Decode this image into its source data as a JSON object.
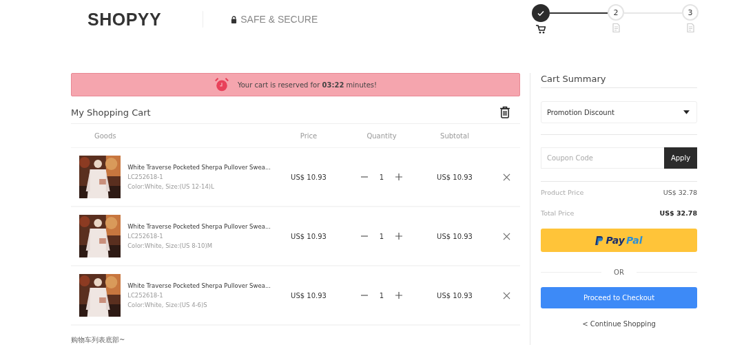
{
  "header": {
    "logo": "SHOPYY",
    "secure_label": "SAFE & SECURE"
  },
  "steps": [
    {
      "kind": "cart",
      "done": true
    },
    {
      "kind": "document",
      "number": "2",
      "done": false
    },
    {
      "kind": "document",
      "number": "3",
      "done": false
    }
  ],
  "reservation_banner": {
    "text": "Your cart is reserved for **03:22** minutes!"
  },
  "cart": {
    "title": "My Shopping Cart",
    "columns": [
      "Goods",
      "Price",
      "Quantity",
      "Subtotal"
    ],
    "rows": [
      {
        "name": "White Traverse Pocketed Sherpa Pullover Swea...",
        "sku": "LC252618-1",
        "variant": "Color:White, Size:(US 12-14)L",
        "price": "US$ 10.93",
        "quantity": "1",
        "subtotal": "US$ 10.93"
      },
      {
        "name": "White Traverse Pocketed Sherpa Pullover Swea...",
        "sku": "LC252618-1",
        "variant": "Color:White, Size:(US 8-10)M",
        "price": "US$ 10.93",
        "quantity": "1",
        "subtotal": "US$ 10.93"
      },
      {
        "name": "White Traverse Pocketed Sherpa Pullover Swea...",
        "sku": "LC252618-1",
        "variant": "Color:White, Size:(US 4-6)S",
        "price": "US$ 10.93",
        "quantity": "1",
        "subtotal": "US$ 10.93"
      }
    ],
    "footer_note": "购物车列表底部~"
  },
  "summary": {
    "title": "Cart Summary",
    "promotion_select": "Promotion Discount",
    "coupon": {
      "placeholder": "Coupon Code",
      "button": "Apply"
    },
    "lines": [
      {
        "label": "Product Price",
        "value": "US$ 32.78",
        "bold": false
      },
      {
        "label": "Total Price",
        "value": "US$ 32.78",
        "bold": true
      }
    ],
    "paypal_button": [
      "Pay",
      "Pal"
    ],
    "separator": "OR",
    "checkout_button": "Proceed to Checkout",
    "continue_link": "< Continue Shopping"
  }
}
